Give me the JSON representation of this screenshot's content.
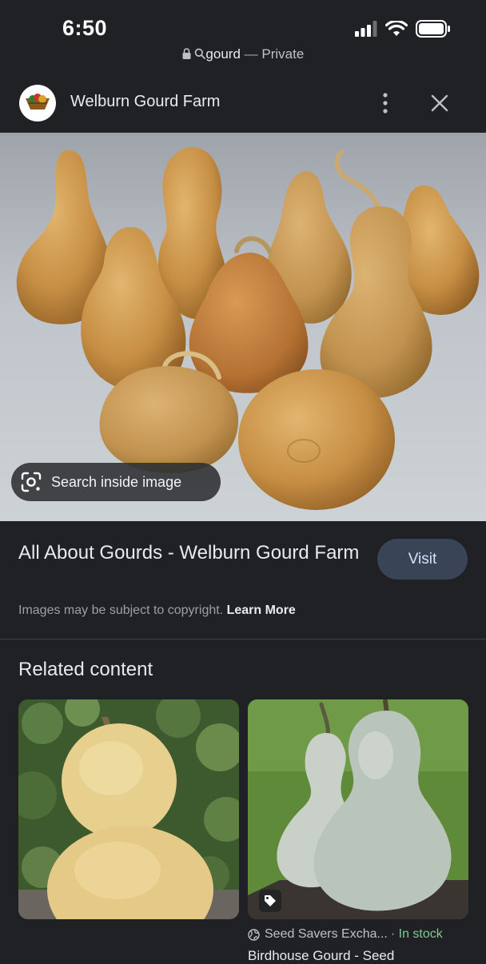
{
  "status_bar": {
    "time": "6:50"
  },
  "url_bar": {
    "query": "gourd",
    "separator": "—",
    "mode": "Private"
  },
  "site": {
    "name": "Welburn Gourd Farm"
  },
  "image": {
    "search_label": "Search inside image"
  },
  "result": {
    "title": "All About Gourds - Welburn Gourd Farm",
    "visit_label": "Visit",
    "copyright_text": "Images may be subject to copyright.",
    "learn_more": "Learn More"
  },
  "related": {
    "heading": "Related content",
    "cards": [
      {
        "source": "",
        "stock": "",
        "title": ""
      },
      {
        "source": "Seed Savers Excha...",
        "stock": "· In stock",
        "title": "Birdhouse Gourd - Seed"
      }
    ]
  },
  "colors": {
    "background": "#202124",
    "visit_button": "#394457",
    "in_stock": "#81c995"
  }
}
